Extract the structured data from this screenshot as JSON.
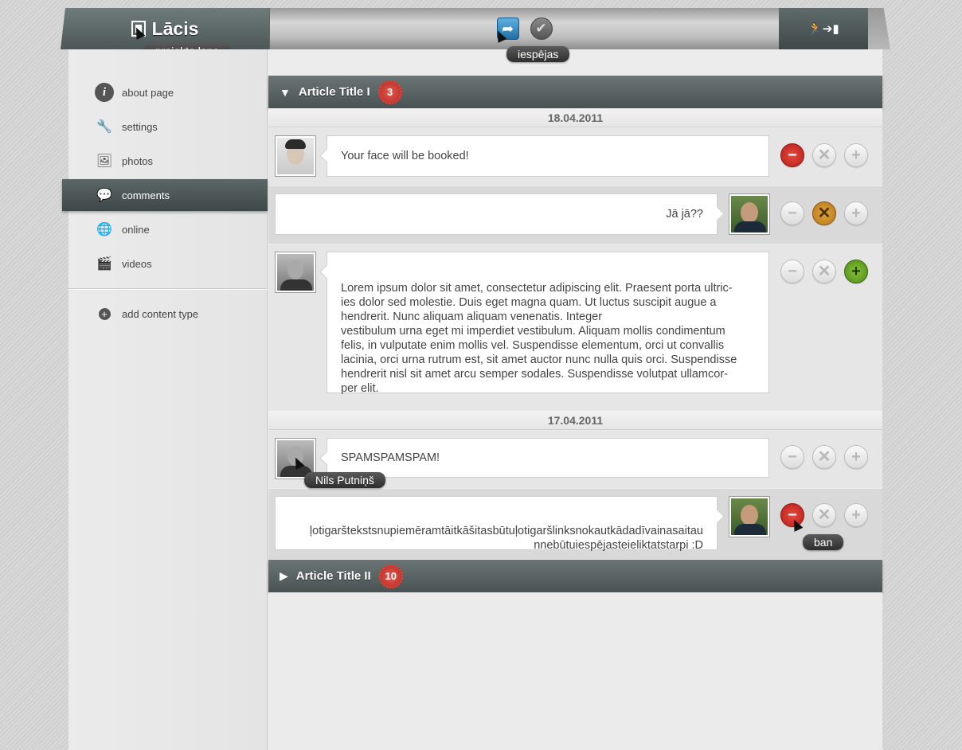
{
  "header": {
    "app_title": "Lācis",
    "project_tooltip": "projekta lapa",
    "options_tooltip": "iespējas",
    "logout_icon": "logout-icon"
  },
  "sidebar": {
    "items": [
      {
        "label": "about page",
        "icon": "info-icon"
      },
      {
        "label": "settings",
        "icon": "wrench-icon"
      },
      {
        "label": "photos",
        "icon": "photos-icon"
      },
      {
        "label": "comments",
        "icon": "speech-bubble-icon",
        "active": true
      },
      {
        "label": "online",
        "icon": "globe-icon"
      },
      {
        "label": "videos",
        "icon": "clapperboard-icon"
      }
    ],
    "add_content_type": "add content type"
  },
  "articles": [
    {
      "title": "Article Title I",
      "count": "3",
      "expanded": true,
      "dates": [
        "18.04.2011",
        "17.04.2011"
      ],
      "comments": [
        {
          "text": "Your face will be booked!",
          "author_side": "left"
        },
        {
          "text": "Jā jā??",
          "author_side": "right"
        },
        {
          "text": "Lorem ipsum dolor sit amet, consectetur adipiscing elit. Praesent porta ultric-\nies dolor sed molestie. Duis eget magna quam. Ut luctus suscipit augue a\nhendrerit. Nunc aliquam aliquam venenatis. Integer\nvestibulum urna eget mi imperdiet vestibulum. Aliquam mollis condimentum\nfelis, in vulputate enim mollis vel. Suspendisse elementum, orci ut convallis\nlacinia, orci urna rutrum est, sit amet auctor nunc nulla quis orci. Suspendisse\nhendrerit nisl sit amet arcu semper sodales. Suspendisse volutpat ullamcor-\nper elit.",
          "author_side": "left"
        },
        {
          "text": "SPAMSPAMSPAM!",
          "author_side": "left",
          "author_tooltip": "Nils Putniņš"
        },
        {
          "text": "ļotigarštekstsnupiemēramtāitkāšitasbūtuļotigaršlinksnokautkādadīvainasaitau\nnnebūtuiespējasteieliktatstarpi :D",
          "author_side": "right",
          "action_tooltip": "ban"
        }
      ]
    },
    {
      "title": "Article Title II",
      "count": "10",
      "expanded": false
    }
  ],
  "colors": {
    "accent_dark": "#4a5353",
    "badge_red": "#c8352c",
    "delete_red": "#c62820",
    "approve_green": "#5a9a1e",
    "warn_orange": "#c98a24"
  }
}
